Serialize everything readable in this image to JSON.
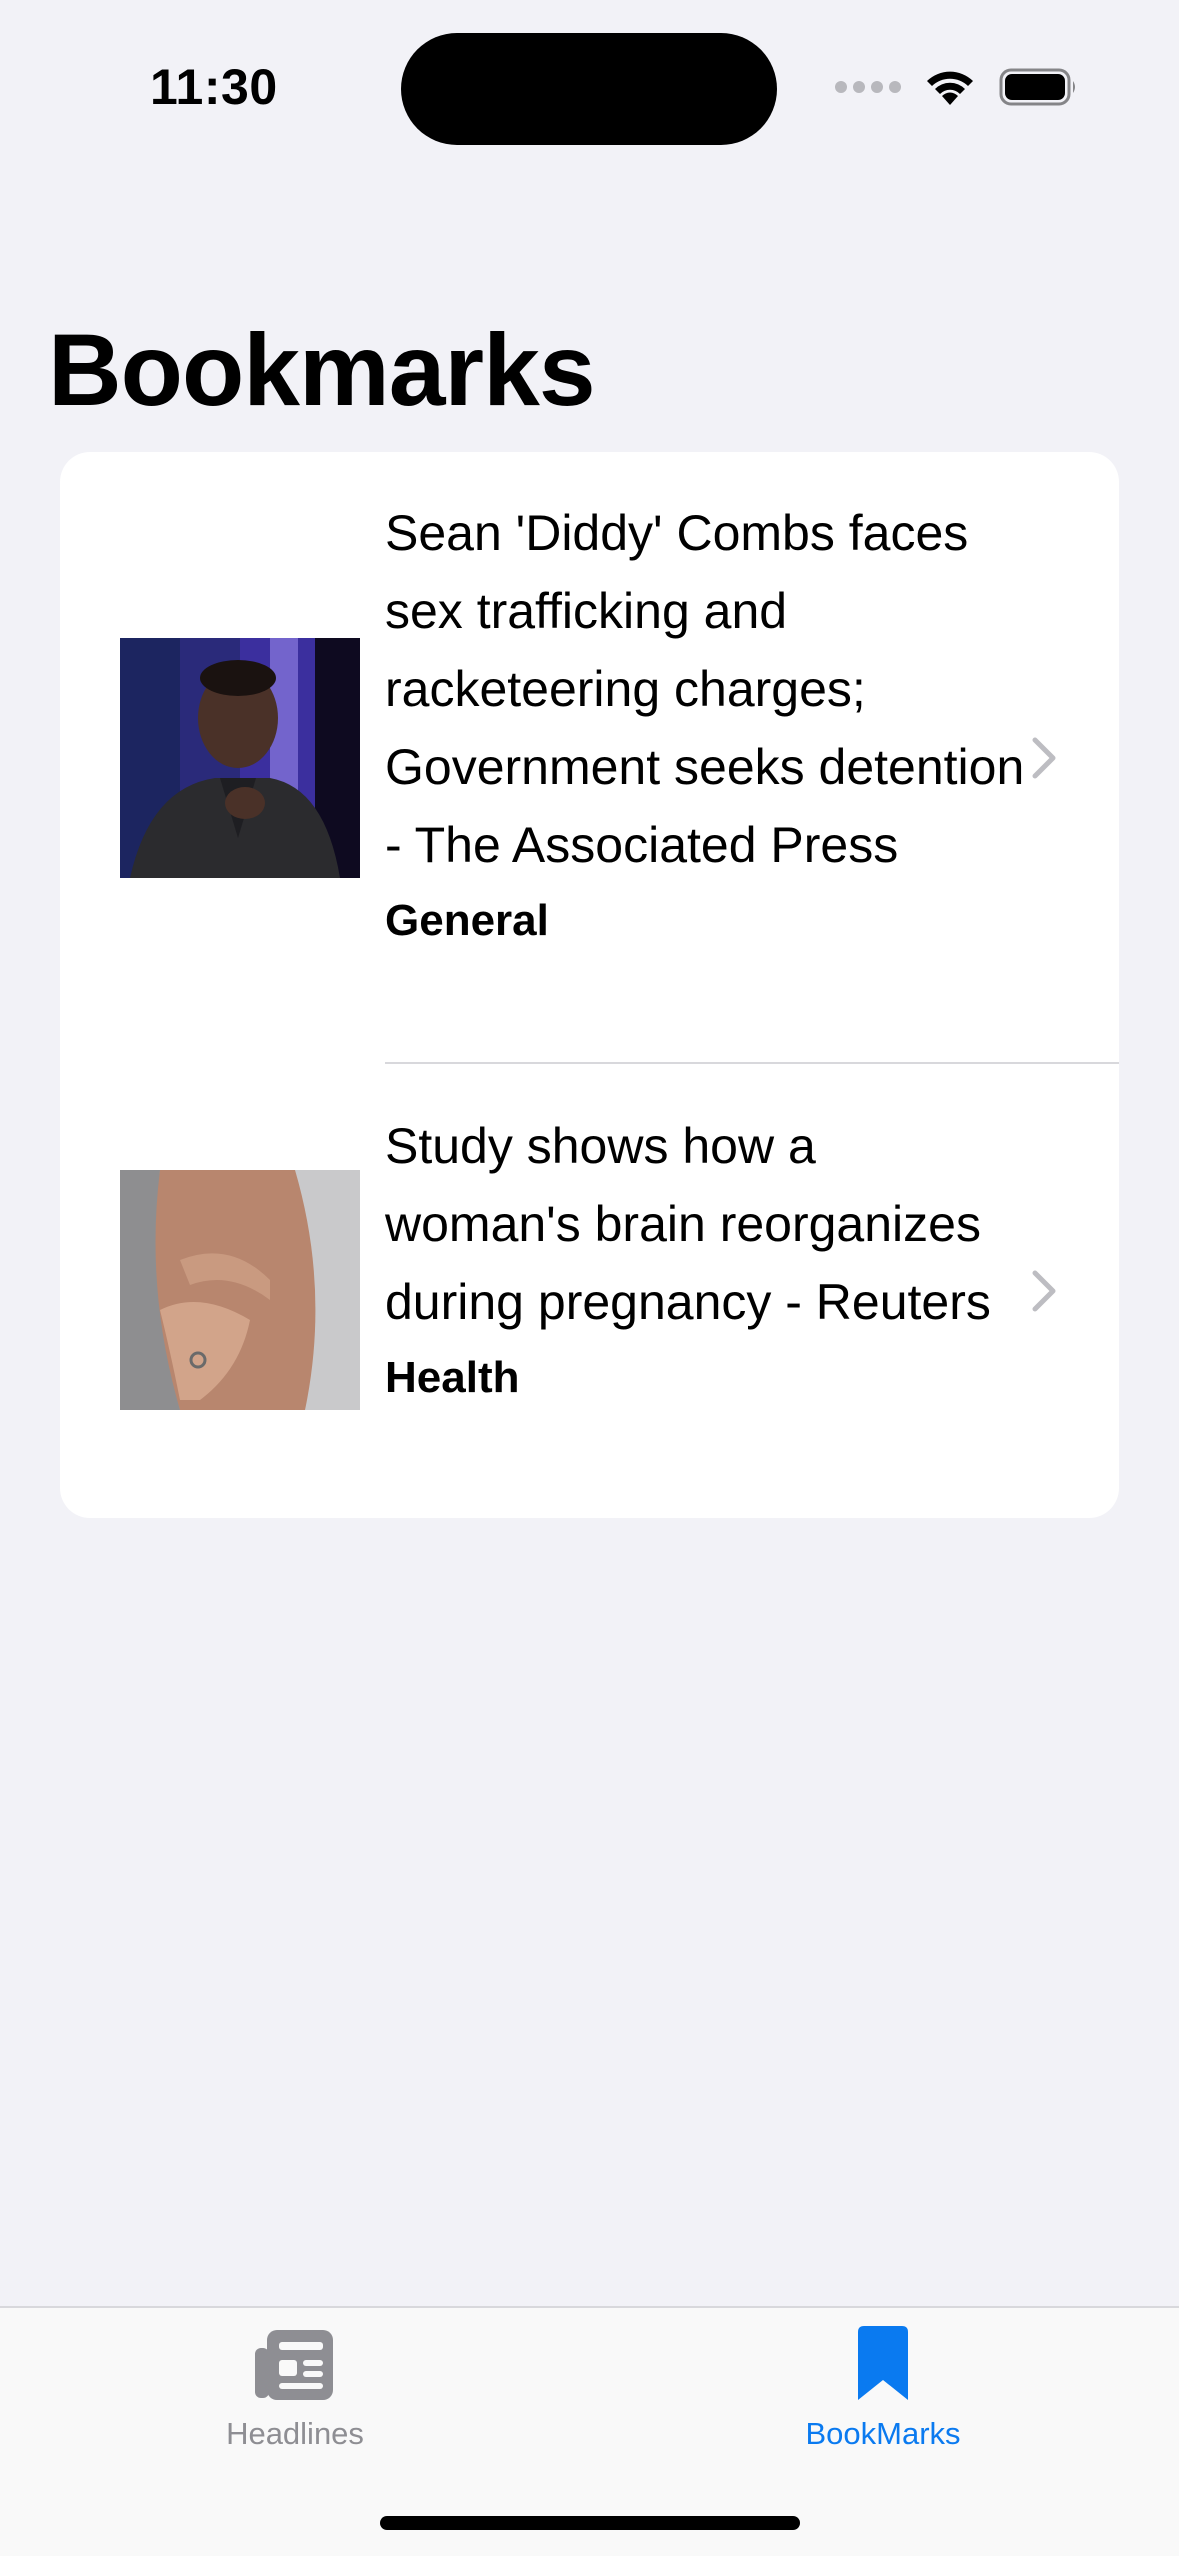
{
  "status_bar": {
    "time": "11:30"
  },
  "page": {
    "title": "Bookmarks"
  },
  "bookmarks": [
    {
      "headline": "Sean 'Diddy' Combs faces sex trafficking and racketeering charges; Government seeks detention - The Associated Press",
      "category": "General",
      "thumbnail_icon": "news-photo-person"
    },
    {
      "headline": "Study shows how a woman's brain reorganizes during pregnancy - Reuters",
      "category": "Health",
      "thumbnail_icon": "news-photo-pregnancy"
    }
  ],
  "tab_bar": {
    "tabs": [
      {
        "label": "Headlines",
        "icon": "newspaper-icon",
        "selected": false
      },
      {
        "label": "BookMarks",
        "icon": "bookmark-icon",
        "selected": true
      }
    ]
  },
  "colors": {
    "accent": "#0A7AF0",
    "inactive": "#8E8E93",
    "background": "#F2F2F7"
  }
}
